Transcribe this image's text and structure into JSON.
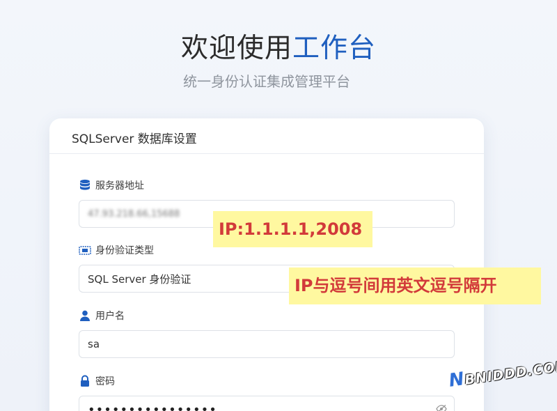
{
  "hero": {
    "title_main": "欢迎使用",
    "title_accent": "工作台",
    "subtitle": "统一身份认证集成管理平台"
  },
  "card": {
    "header": "SQLServer 数据库设置",
    "fields": {
      "server": {
        "label": "服务器地址",
        "value": "47.93.218.66,15688",
        "icon": "database-icon"
      },
      "auth": {
        "label": "身份验证类型",
        "value": "SQL Server 身份验证",
        "icon": "id-card-icon"
      },
      "user": {
        "label": "用户名",
        "value": "sa",
        "icon": "user-icon"
      },
      "password": {
        "label": "密码",
        "value": "••••••••••••••••",
        "icon": "lock-icon"
      }
    }
  },
  "annotations": {
    "note1": "IP:1.1.1.1,2008",
    "note2": "IP与逗号间用英文逗号隔开"
  },
  "watermark": {
    "n": "N",
    "text": "BNIDDD.COM"
  },
  "colors": {
    "accent": "#1f5fbf",
    "note_bg": "#fff8a0",
    "note_text": "#d23a3a"
  }
}
